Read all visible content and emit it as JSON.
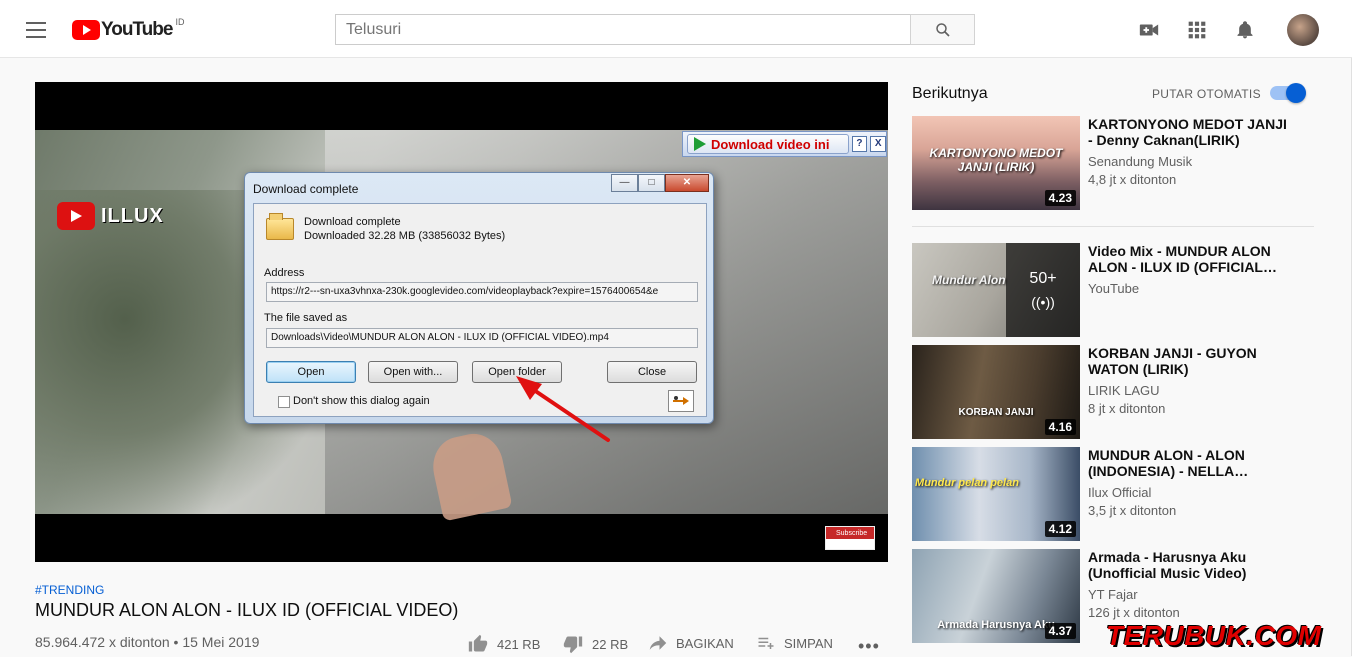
{
  "header": {
    "logo_text": "YouTube",
    "logo_region": "ID",
    "search_placeholder": "Telusuri",
    "icons": [
      "menu-icon",
      "search-icon",
      "create-video-icon",
      "apps-grid-icon",
      "notifications-bell-icon",
      "avatar"
    ]
  },
  "player": {
    "channel_logo_text": "ILLUX",
    "download_bar": {
      "label": "Download video ini",
      "help": "?",
      "close": "X"
    },
    "subscribe_badge": "Subscribe"
  },
  "dialog": {
    "title": "Download complete",
    "controls": {
      "minimize": "—",
      "maximize": "□",
      "close": "✕"
    },
    "status_line1": "Download complete",
    "status_line2": "Downloaded 32.28  MB (33856032 Bytes)",
    "address_label": "Address",
    "address_value": "https://r2---sn-uxa3vhnxa-230k.googlevideo.com/videoplayback?expire=1576400654&e",
    "saved_label": "The file saved as",
    "saved_value": "Downloads\\Video\\MUNDUR ALON ALON - ILUX ID (OFFICIAL VIDEO).mp4",
    "buttons": {
      "open": "Open",
      "open_with": "Open with...",
      "open_folder": "Open folder",
      "close": "Close"
    },
    "checkbox_label": "Don't show this dialog again",
    "checkbox_checked": false
  },
  "video_meta": {
    "tag": "#TRENDING",
    "title": "MUNDUR ALON ALON - ILUX ID (OFFICIAL VIDEO)",
    "views_date": "85.964.472 x ditonton • 15 Mei 2019",
    "likes": "421 RB",
    "dislikes": "22 RB",
    "share": "BAGIKAN",
    "save": "SIMPAN",
    "more": "•••"
  },
  "sidebar": {
    "heading": "Berikutnya",
    "autoplay_label": "PUTAR OTOMATIS",
    "autoplay_on": true,
    "items": [
      {
        "title": "KARTONYONO MEDOT JANJI - Denny Caknan(LIRIK)",
        "channel": "Senandung Musik",
        "views": "4,8 jt x ditonton",
        "duration": "4.23",
        "thumb_caption": "KARTONYONO MEDOT JANJI (LIRIK)"
      },
      {
        "title": "Video Mix - MUNDUR ALON ALON - ILUX ID (OFFICIAL…",
        "channel": "YouTube",
        "views": "",
        "duration": "",
        "thumb_caption": "Mundur Alon",
        "mix_count": "50+",
        "mix_icon": "((•))"
      },
      {
        "title": "KORBAN JANJI - GUYON WATON (LIRIK)",
        "channel": "LIRIK LAGU",
        "views": "8 jt x ditonton",
        "duration": "4.16",
        "thumb_caption": "KORBAN JANJI"
      },
      {
        "title": "MUNDUR ALON - ALON (INDONESIA) - NELLA…",
        "channel": "Ilux Official",
        "views": "3,5 jt x ditonton",
        "duration": "4.12",
        "thumb_caption": "Mundur pelan pelan"
      },
      {
        "title": "Armada - Harusnya Aku (Unofficial Music Video)",
        "channel": "YT Fajar",
        "views": "126 jt x ditonton",
        "duration": "4.37",
        "thumb_caption": "Armada Harusnya Aku"
      }
    ]
  },
  "watermark": "TERUBUK.COM",
  "colors": {
    "brand_red": "#ff0000",
    "link_blue": "#065fd4",
    "toggle_blue": "#065fd4",
    "arrow_red": "#e01010"
  }
}
